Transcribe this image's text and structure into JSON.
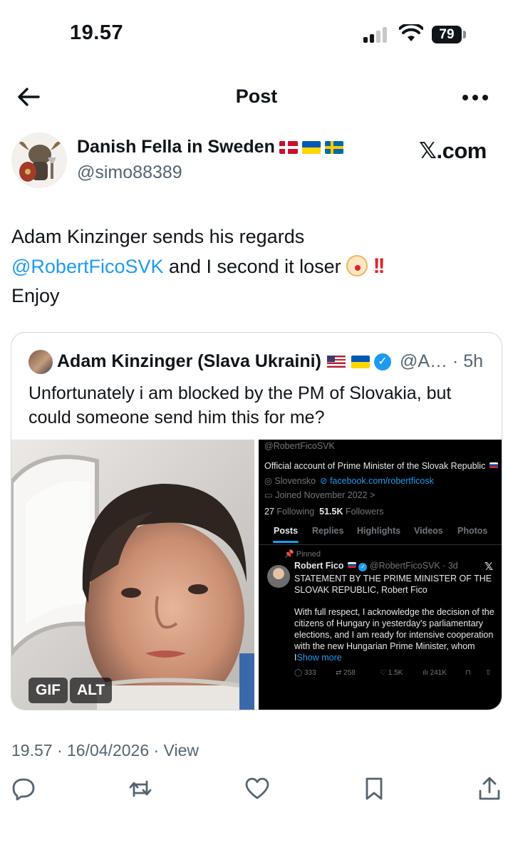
{
  "status_bar": {
    "time": "19.57",
    "battery": "79"
  },
  "header": {
    "title": "Post"
  },
  "author": {
    "name": "Danish Fella in Sweden",
    "handle": "@simo88389",
    "source": "𝕏.com"
  },
  "tweet": {
    "line1": "Adam Kinzinger sends his regards",
    "mention": "@RobertFicoSVK",
    "line2_rest": " and I second it loser ",
    "line3": "Enjoy"
  },
  "quote": {
    "name": "Adam Kinzinger (Slava Ukraini)",
    "meta": "@A… · 5h",
    "text": "Unfortunately i am blocked by the PM of Slovakia, but could someone send him this for me?",
    "badges": {
      "gif": "GIF",
      "alt": "ALT"
    },
    "screenshot": {
      "handle": "@RobertFicoSVK",
      "bio": "Official account of Prime Minister of the Slovak Republic",
      "location": "Slovensko",
      "website": "facebook.com/robertficosk",
      "joined": "Joined November 2022 >",
      "following_count": "27",
      "following_label": "Following",
      "followers_count": "51.5K",
      "followers_label": "Followers",
      "tabs": [
        "Posts",
        "Replies",
        "Highlights",
        "Videos",
        "Photos"
      ],
      "pinned_label": "Pinned",
      "post_author": "Robert Fico",
      "post_meta": "@RobertFicoSVK · 3d",
      "post_line1": "STATEMENT BY THE PRIME MINISTER OF THE",
      "post_line2": "SLOVAK REPUBLIC, Robert Fico",
      "post_body1": "With full respect, I acknowledge the decision of the",
      "post_body2": "citizens of Hungary in yesterday's parliamentary",
      "post_body3": "elections, and I am ready for intensive cooperation",
      "post_body4": "with the new Hungarian Prime Minister, whom",
      "post_body5_prefix": "I",
      "show_more": "Show more",
      "stats": {
        "replies": "333",
        "reposts": "258",
        "likes": "1.5K",
        "views": "241K"
      }
    }
  },
  "footer": {
    "timestamp": "19.57 · 16/04/2026 · View"
  },
  "icons": {
    "back": "arrow-left-icon",
    "more": "more-horizontal-icon",
    "reply": "reply-icon",
    "repost": "repost-icon",
    "like": "heart-icon",
    "bookmark": "bookmark-icon",
    "share": "share-icon"
  },
  "colors": {
    "accent": "#1d9bf0",
    "text": "#0f1419",
    "muted": "#536471",
    "danger": "#e0242c"
  }
}
